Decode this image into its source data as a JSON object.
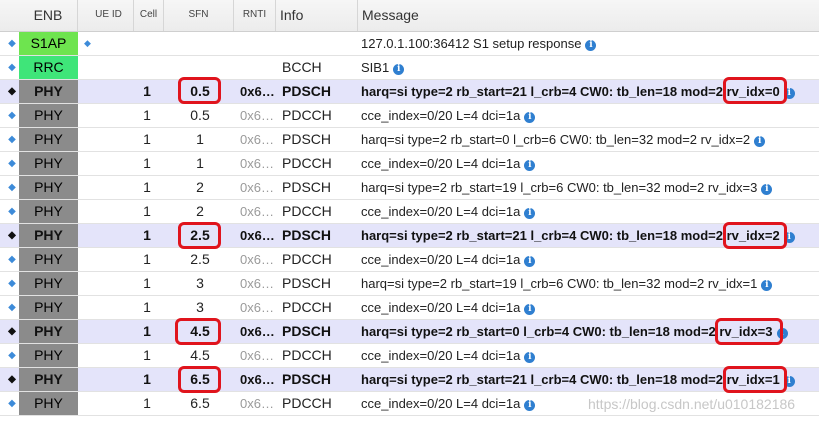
{
  "columns": {
    "enb": "ENB",
    "ue_id": "UE ID",
    "cell": "Cell",
    "sfn": "SFN",
    "rnti": "RNTI",
    "info": "Info",
    "message": "Message"
  },
  "colors": {
    "phy": "#8b8b8b",
    "s1ap": "#6ee44f",
    "rrc": "#3fe579",
    "highlight_row": "#e4e4fa",
    "annotation": "#e0141d"
  },
  "rows": [
    {
      "layer": "S1AP",
      "cell": "",
      "sfn": "",
      "rnti": "",
      "info": "",
      "message": "127.0.1.100:36412 S1 setup response",
      "highlight": false
    },
    {
      "layer": "RRC",
      "cell": "",
      "sfn": "",
      "rnti": "",
      "info": "BCCH",
      "message": "SIB1",
      "highlight": false
    },
    {
      "layer": "PHY",
      "cell": "1",
      "sfn": "0.5",
      "rnti": "0x6…",
      "info": "PDSCH",
      "message": "harq=si type=2 rb_start=21 l_crb=4 CW0: tb_len=18 mod=2 rv_idx=0",
      "highlight": true
    },
    {
      "layer": "PHY",
      "cell": "1",
      "sfn": "0.5",
      "rnti": "0x6…",
      "info": "PDCCH",
      "message": "cce_index=0/20 L=4 dci=1a",
      "highlight": false
    },
    {
      "layer": "PHY",
      "cell": "1",
      "sfn": "1",
      "rnti": "0x6…",
      "info": "PDSCH",
      "message": "harq=si type=2 rb_start=0 l_crb=6 CW0: tb_len=32 mod=2 rv_idx=2",
      "highlight": false
    },
    {
      "layer": "PHY",
      "cell": "1",
      "sfn": "1",
      "rnti": "0x6…",
      "info": "PDCCH",
      "message": "cce_index=0/20 L=4 dci=1a",
      "highlight": false
    },
    {
      "layer": "PHY",
      "cell": "1",
      "sfn": "2",
      "rnti": "0x6…",
      "info": "PDSCH",
      "message": "harq=si type=2 rb_start=19 l_crb=6 CW0: tb_len=32 mod=2 rv_idx=3",
      "highlight": false
    },
    {
      "layer": "PHY",
      "cell": "1",
      "sfn": "2",
      "rnti": "0x6…",
      "info": "PDCCH",
      "message": "cce_index=0/20 L=4 dci=1a",
      "highlight": false
    },
    {
      "layer": "PHY",
      "cell": "1",
      "sfn": "2.5",
      "rnti": "0x6…",
      "info": "PDSCH",
      "message": "harq=si type=2 rb_start=21 l_crb=4 CW0: tb_len=18 mod=2 rv_idx=2",
      "highlight": true
    },
    {
      "layer": "PHY",
      "cell": "1",
      "sfn": "2.5",
      "rnti": "0x6…",
      "info": "PDCCH",
      "message": "cce_index=0/20 L=4 dci=1a",
      "highlight": false
    },
    {
      "layer": "PHY",
      "cell": "1",
      "sfn": "3",
      "rnti": "0x6…",
      "info": "PDSCH",
      "message": "harq=si type=2 rb_start=19 l_crb=6 CW0: tb_len=32 mod=2 rv_idx=1",
      "highlight": false
    },
    {
      "layer": "PHY",
      "cell": "1",
      "sfn": "3",
      "rnti": "0x6…",
      "info": "PDCCH",
      "message": "cce_index=0/20 L=4 dci=1a",
      "highlight": false
    },
    {
      "layer": "PHY",
      "cell": "1",
      "sfn": "4.5",
      "rnti": "0x6…",
      "info": "PDSCH",
      "message": "harq=si type=2 rb_start=0 l_crb=4 CW0: tb_len=18 mod=2 rv_idx=3",
      "highlight": true
    },
    {
      "layer": "PHY",
      "cell": "1",
      "sfn": "4.5",
      "rnti": "0x6…",
      "info": "PDCCH",
      "message": "cce_index=0/20 L=4 dci=1a",
      "highlight": false
    },
    {
      "layer": "PHY",
      "cell": "1",
      "sfn": "6.5",
      "rnti": "0x6…",
      "info": "PDSCH",
      "message": "harq=si type=2 rb_start=21 l_crb=4 CW0: tb_len=18 mod=2 rv_idx=1",
      "highlight": true
    },
    {
      "layer": "PHY",
      "cell": "1",
      "sfn": "6.5",
      "rnti": "0x6…",
      "info": "PDCCH",
      "message": "cce_index=0/20 L=4 dci=1a",
      "highlight": false
    }
  ],
  "info_icon_glyph": "i",
  "expand_icon_glyph": "◆",
  "watermark": "https://blog.csdn.net/u010182186"
}
